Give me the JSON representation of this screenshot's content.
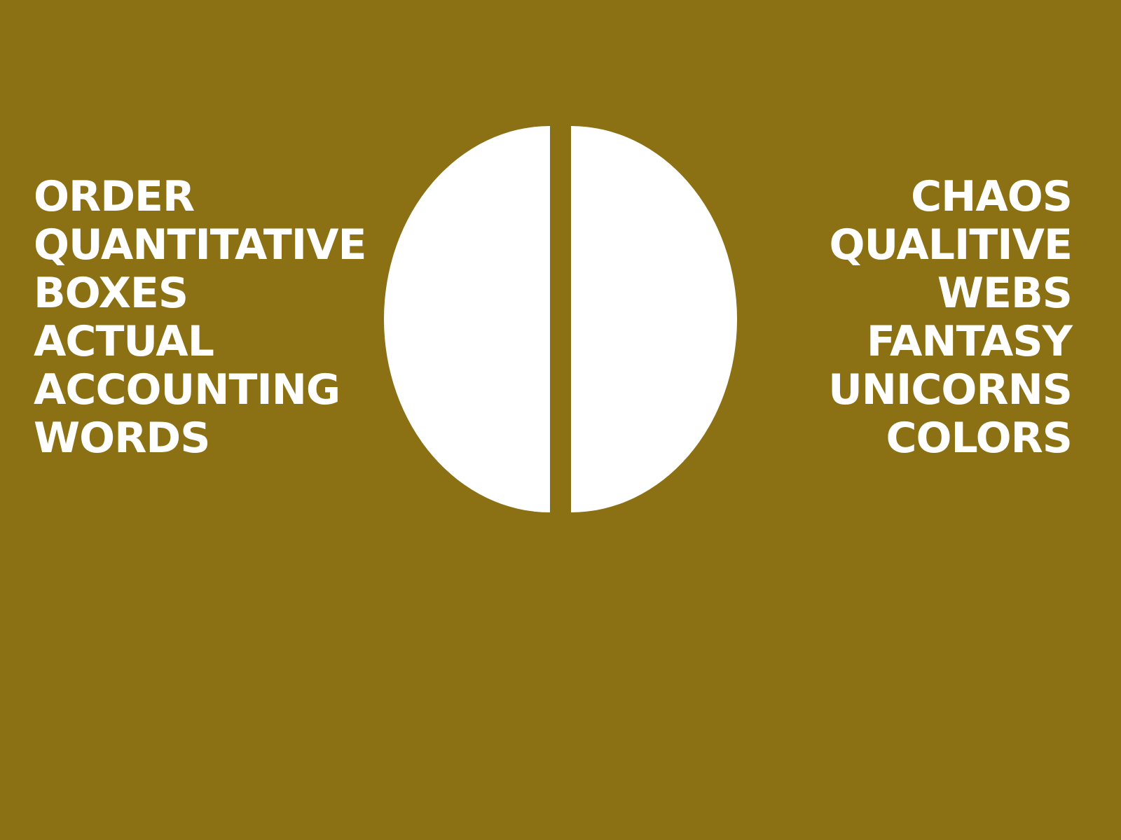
{
  "background_color": "#8b7114",
  "foreground_color": "#ffffff",
  "left_words": [
    "ORDER",
    "QUANTITATIVE",
    "BOXES",
    "ACTUAL",
    "ACCOUNTING",
    "WORDS"
  ],
  "right_words": [
    "CHAOS",
    "QUALITIVE",
    "WEBS",
    "FANTASY",
    "UNICORNS",
    "COLORS"
  ]
}
